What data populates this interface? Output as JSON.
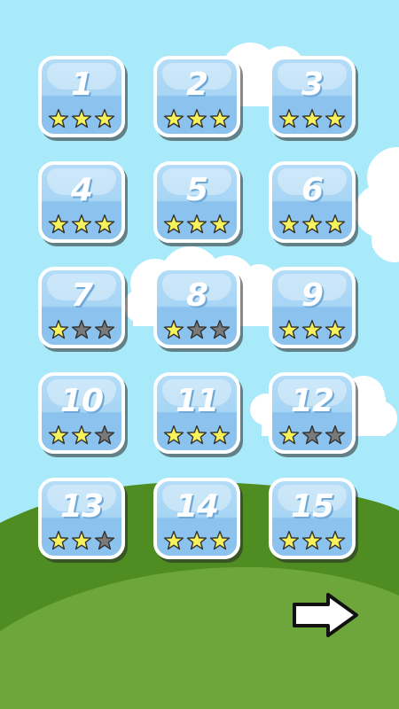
{
  "colors": {
    "sky": "#a8eaf9",
    "hill_back": "#4f8d22",
    "hill_front": "#6da63a",
    "star_filled": "#f7f25a",
    "star_empty": "#7a7a7a",
    "tile_light": "#b3dcf7",
    "tile_dark": "#8bc3ee"
  },
  "levels": [
    {
      "number": "1",
      "stars": 3
    },
    {
      "number": "2",
      "stars": 3
    },
    {
      "number": "3",
      "stars": 3
    },
    {
      "number": "4",
      "stars": 3
    },
    {
      "number": "5",
      "stars": 3
    },
    {
      "number": "6",
      "stars": 3
    },
    {
      "number": "7",
      "stars": 1
    },
    {
      "number": "8",
      "stars": 1
    },
    {
      "number": "9",
      "stars": 3
    },
    {
      "number": "10",
      "stars": 2
    },
    {
      "number": "11",
      "stars": 3
    },
    {
      "number": "12",
      "stars": 1
    },
    {
      "number": "13",
      "stars": 2
    },
    {
      "number": "14",
      "stars": 3
    },
    {
      "number": "15",
      "stars": 3
    }
  ],
  "max_stars": 3,
  "next_button": {
    "icon": "right-arrow-icon"
  }
}
